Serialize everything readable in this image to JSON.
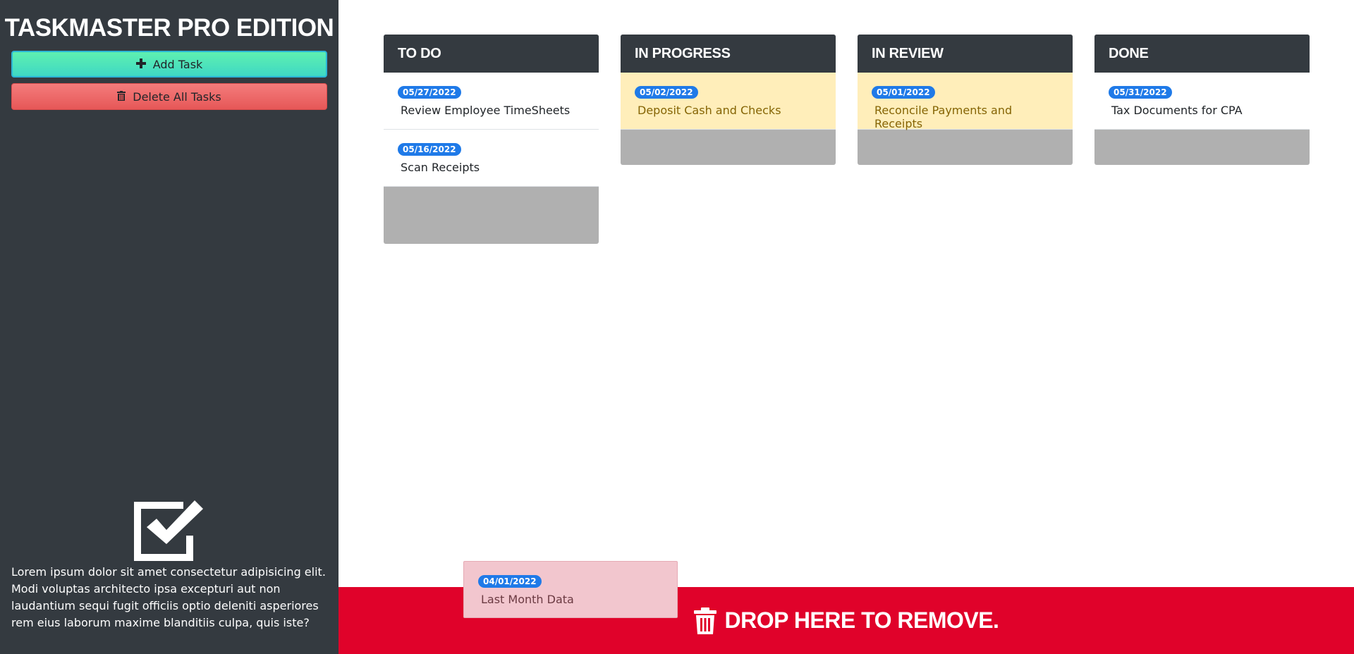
{
  "sidebar": {
    "title": "TASKMASTER PRO EDITION",
    "add_label": "Add Task",
    "delete_label": "Delete All Tasks",
    "description": "Lorem ipsum dolor sit amet consectetur adipisicing elit. Modi voluptas architecto ipsa excepturi aut non laudantium sequi fugit officiis optio deleniti asperiores rem eius laborum maxime blanditiis culpa, quis iste?"
  },
  "columns": [
    {
      "title": "TO DO",
      "tasks": [
        {
          "date": "05/27/2022",
          "text": "Review Employee TimeSheets",
          "status": "normal"
        },
        {
          "date": "05/16/2022",
          "text": "Scan Receipts",
          "status": "normal"
        }
      ]
    },
    {
      "title": "IN PROGRESS",
      "tasks": [
        {
          "date": "05/02/2022",
          "text": "Deposit Cash and Checks",
          "status": "warning"
        }
      ]
    },
    {
      "title": "IN REVIEW",
      "tasks": [
        {
          "date": "05/01/2022",
          "text": "Reconcile Payments and Receipts",
          "status": "warning"
        }
      ]
    },
    {
      "title": "DONE",
      "tasks": [
        {
          "date": "05/31/2022",
          "text": "Tax Documents for CPA",
          "status": "normal"
        }
      ]
    }
  ],
  "dragging_task": {
    "date": "04/01/2022",
    "text": "Last Month Data",
    "status": "overdue"
  },
  "remove_zone": {
    "label": "DROP HERE TO REMOVE."
  },
  "colors": {
    "sidebar_bg": "#343a40",
    "badge": "#1f7ae8",
    "warning_card": "#ffeeba",
    "overdue_card": "#f2c6ce",
    "remove_zone": "#e0022a"
  }
}
